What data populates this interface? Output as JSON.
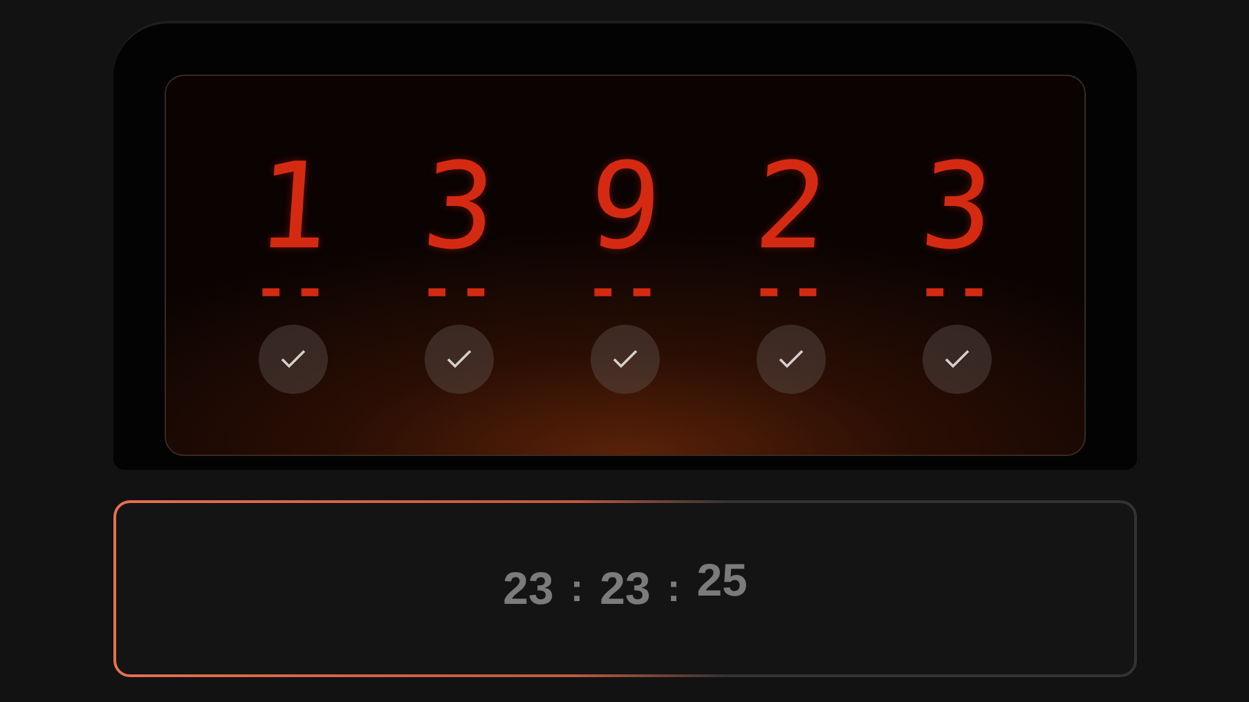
{
  "display": {
    "columns": [
      {
        "digit": "1",
        "dashes": "--",
        "checked": true
      },
      {
        "digit": "3",
        "dashes": "--",
        "checked": true
      },
      {
        "digit": "9",
        "dashes": "--",
        "checked": true
      },
      {
        "digit": "2",
        "dashes": "--",
        "checked": true
      },
      {
        "digit": "3",
        "dashes": "--",
        "checked": true
      }
    ]
  },
  "timer": {
    "parts": [
      {
        "kind": "number",
        "text": "23"
      },
      {
        "kind": "separator",
        "text": ":"
      },
      {
        "kind": "number",
        "text": "23"
      },
      {
        "kind": "separator",
        "text": ":"
      },
      {
        "kind": "raised",
        "text": "25"
      }
    ]
  }
}
